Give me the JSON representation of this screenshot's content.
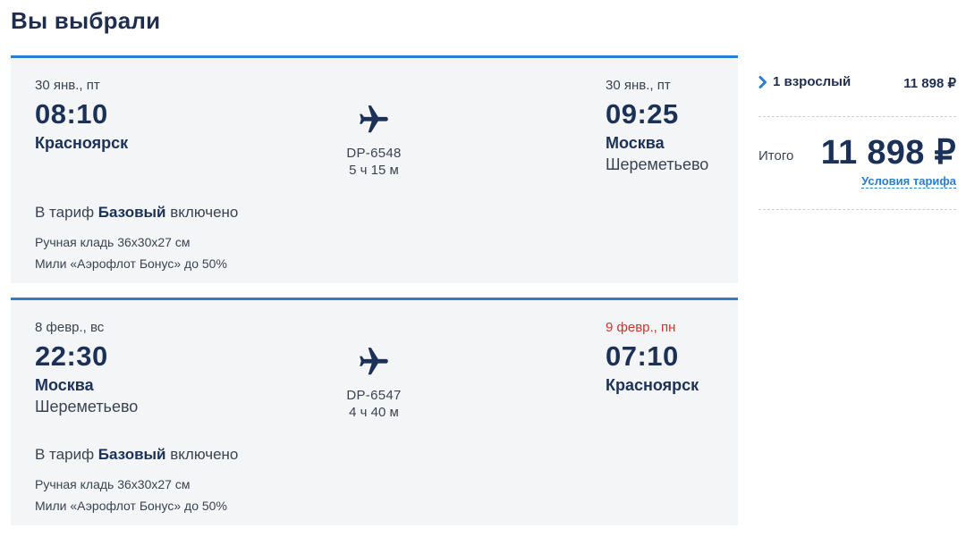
{
  "page": {
    "title": "Вы выбрали"
  },
  "flights": [
    {
      "departure": {
        "date": "30 янв., пт",
        "time": "08:10",
        "city": "Красноярск",
        "airport": ""
      },
      "arrival": {
        "date": "30 янв., пт",
        "time": "09:25",
        "city": "Москва",
        "airport": "Шереметьево",
        "date_color": "#3a4352"
      },
      "flight_number": "DP-6548",
      "duration": "5 ч 15 м",
      "tariff": {
        "prefix": "В тариф",
        "name": "Базовый",
        "suffix": "включено"
      },
      "included": [
        "Ручная кладь 36х30х27 см",
        "Мили «Аэрофлот Бонус» до 50%"
      ],
      "icon": "airplane-icon"
    },
    {
      "departure": {
        "date": "8 февр., вс",
        "time": "22:30",
        "city": "Москва",
        "airport": "Шереметьево"
      },
      "arrival": {
        "date": "9 февр., пн",
        "time": "07:10",
        "city": "Красноярск",
        "airport": "",
        "date_color": "#d2342b"
      },
      "flight_number": "DP-6547",
      "duration": "4 ч 40 м",
      "tariff": {
        "prefix": "В тариф",
        "name": "Базовый",
        "suffix": "включено"
      },
      "included": [
        "Ручная кладь 36х30х27 см",
        "Мили «Аэрофлот Бонус» до 50%"
      ],
      "icon": "airplane-icon"
    }
  ],
  "summary": {
    "passengers_label": "1 взрослый",
    "passengers_price": "11 898 ₽",
    "total_label": "Итого",
    "total_price": "11 898 ₽",
    "fare_conditions_link": "Условия тарифа",
    "icon": "chevron-right-icon"
  },
  "colors": {
    "accent": "#2b7ed0",
    "navy": "#1b3157",
    "alert": "#d2342b",
    "card_bg": "#f4f5f6"
  }
}
